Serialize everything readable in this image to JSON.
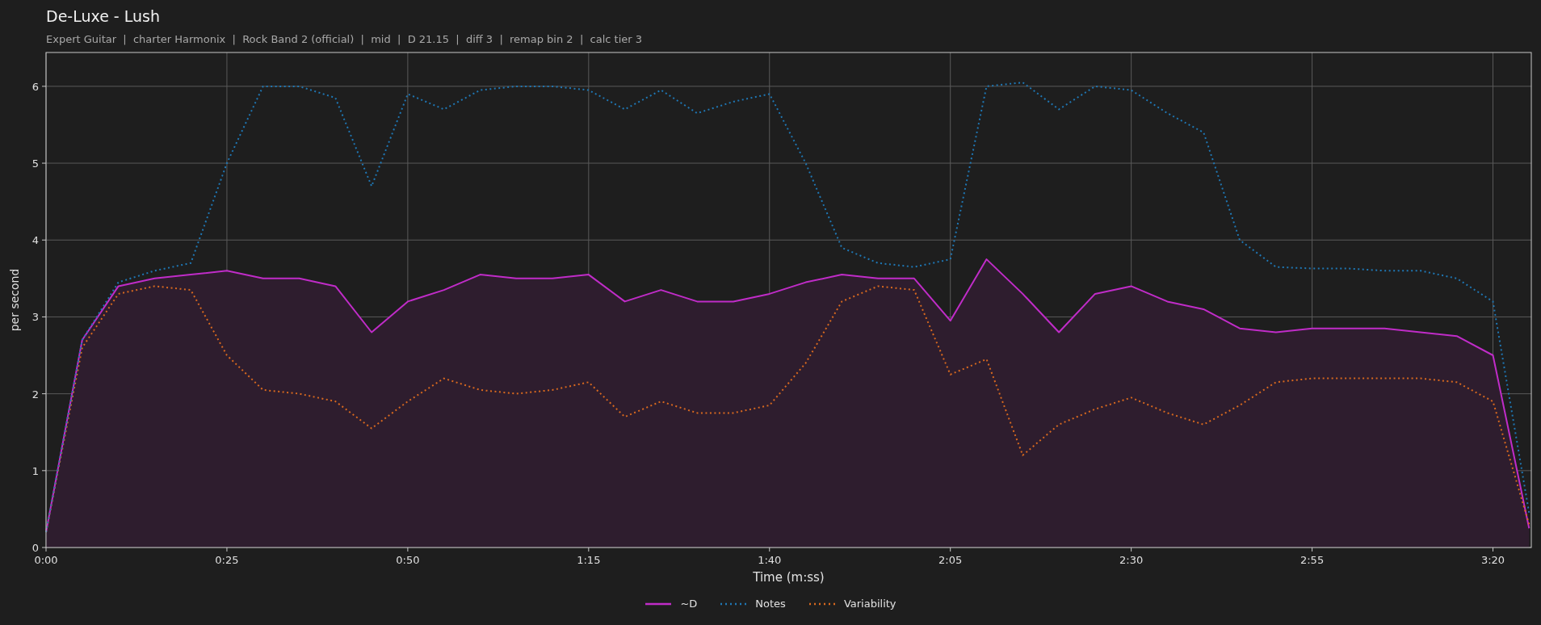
{
  "title": "De-Luxe - Lush",
  "subtitle": "Expert Guitar  |  charter Harmonix  |  Rock Band 2 (official)  |  mid  |  D 21.15  |  diff 3  |  remap bin 2  |  calc tier 3",
  "chart": {
    "chart_data": {
      "type": "line",
      "xlabel": "Time (m:ss)",
      "ylabel": "per second",
      "x": [
        0,
        5,
        10,
        15,
        20,
        25,
        30,
        35,
        40,
        45,
        50,
        55,
        60,
        65,
        70,
        75,
        80,
        85,
        90,
        95,
        100,
        105,
        110,
        115,
        120,
        125,
        130,
        135,
        140,
        145,
        150,
        155,
        160,
        165,
        170,
        175,
        180,
        185,
        190,
        195,
        200,
        205
      ],
      "series": [
        {
          "name": "~D",
          "color": "#c02cc8",
          "line_style": "solid",
          "values": [
            0.2,
            2.7,
            3.4,
            3.5,
            3.55,
            3.6,
            3.5,
            3.5,
            3.4,
            2.8,
            3.2,
            3.35,
            3.55,
            3.5,
            3.5,
            3.55,
            3.2,
            3.35,
            3.2,
            3.2,
            3.3,
            3.45,
            3.55,
            3.5,
            3.5,
            2.95,
            3.75,
            3.3,
            2.8,
            3.3,
            3.4,
            3.2,
            3.1,
            2.85,
            2.8,
            2.85,
            2.85,
            2.85,
            2.8,
            2.75,
            2.5,
            0.25
          ]
        },
        {
          "name": "Notes",
          "color": "#1f77b4",
          "line_style": "dotted",
          "values": [
            0.2,
            2.7,
            3.45,
            3.6,
            3.7,
            5.0,
            6.0,
            6.0,
            5.85,
            4.7,
            5.9,
            5.7,
            5.95,
            6.0,
            6.0,
            5.95,
            5.7,
            5.95,
            5.65,
            5.8,
            5.9,
            5.0,
            3.9,
            3.7,
            3.65,
            3.75,
            6.0,
            6.05,
            5.7,
            6.0,
            5.95,
            5.65,
            5.4,
            4.0,
            3.65,
            3.63,
            3.63,
            3.6,
            3.6,
            3.5,
            3.2,
            0.45
          ]
        },
        {
          "name": "Variability",
          "color": "#d8691f",
          "line_style": "dotted",
          "values": [
            0.2,
            2.6,
            3.3,
            3.4,
            3.35,
            2.5,
            2.05,
            2.0,
            1.9,
            1.55,
            1.9,
            2.2,
            2.05,
            2.0,
            2.05,
            2.15,
            1.7,
            1.9,
            1.75,
            1.75,
            1.85,
            2.4,
            3.2,
            3.4,
            3.35,
            2.25,
            2.45,
            1.2,
            1.6,
            1.8,
            1.95,
            1.75,
            1.6,
            1.85,
            2.15,
            2.2,
            2.2,
            2.2,
            2.2,
            2.15,
            1.9,
            0.3
          ]
        }
      ],
      "grid": true,
      "xlim": [
        0,
        205.3
      ],
      "ylim": [
        0,
        6.44
      ],
      "xticks": [
        {
          "value": 0,
          "label": "0:00"
        },
        {
          "value": 25,
          "label": "0:25"
        },
        {
          "value": 50,
          "label": "0:50"
        },
        {
          "value": 75,
          "label": "1:15"
        },
        {
          "value": 100,
          "label": "1:40"
        },
        {
          "value": 125,
          "label": "2:05"
        },
        {
          "value": 150,
          "label": "2:30"
        },
        {
          "value": 175,
          "label": "2:55"
        },
        {
          "value": 200,
          "label": "3:20"
        }
      ],
      "yticks": [
        0,
        1,
        2,
        3,
        4,
        5,
        6
      ]
    }
  }
}
